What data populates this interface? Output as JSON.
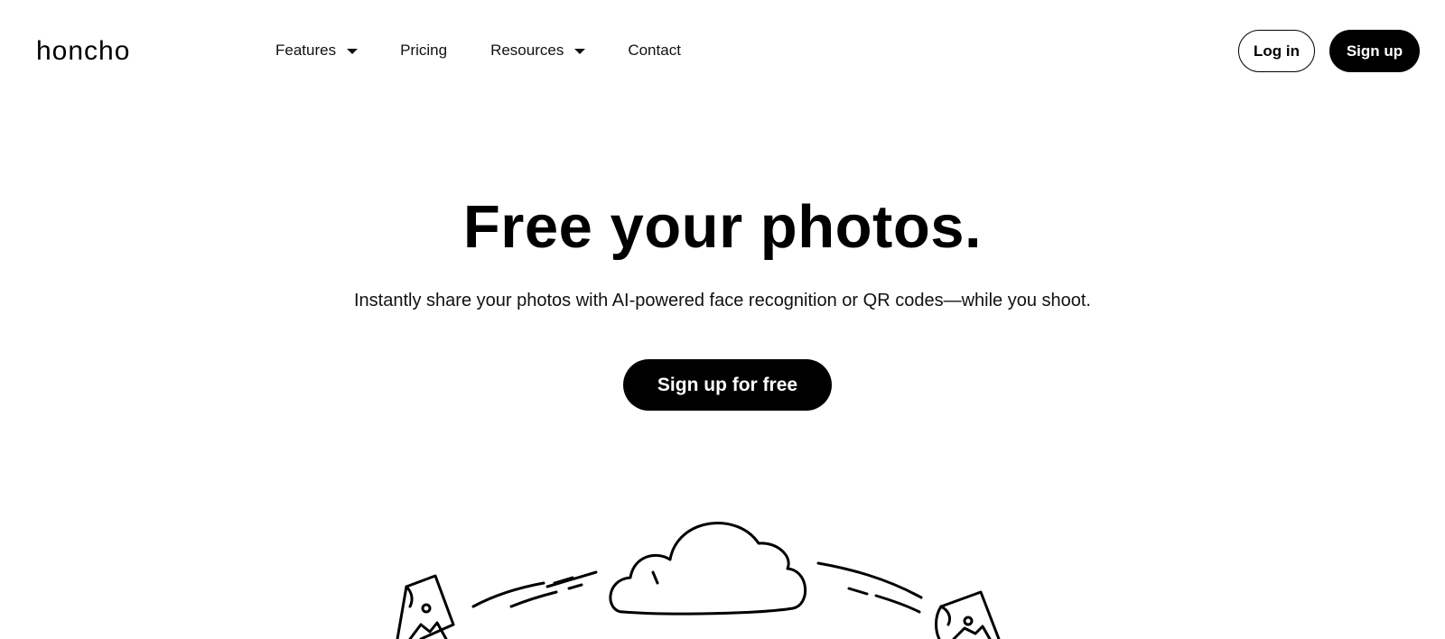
{
  "header": {
    "logo_text": "honcho",
    "nav": {
      "features_label": "Features",
      "pricing_label": "Pricing",
      "resources_label": "Resources",
      "contact_label": "Contact"
    },
    "login_label": "Log in",
    "signup_label": "Sign up"
  },
  "hero": {
    "title": "Free your photos.",
    "subtitle": "Instantly share your photos with AI-powered face recognition or QR codes—while you shoot.",
    "cta_label": "Sign up for free"
  },
  "icons": {
    "logo": "honcho-logo",
    "dropdown": "caret-down-icon",
    "illustration": "cloud-sync-illustration"
  }
}
